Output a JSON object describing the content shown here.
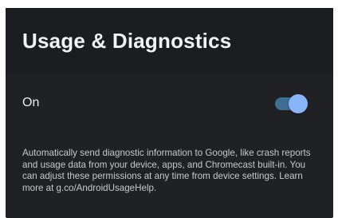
{
  "header": {
    "title": "Usage & Diagnostics"
  },
  "toggle_row": {
    "label": "On",
    "state": "on",
    "accent_color": "#8ab4f8"
  },
  "description": "Automatically send diagnostic information to Google, like crash reports and usage data from your device, apps, and Chromecast built-in. You can adjust these permissions at any time from device settings. Learn more at g.co/AndroidUsageHelp."
}
